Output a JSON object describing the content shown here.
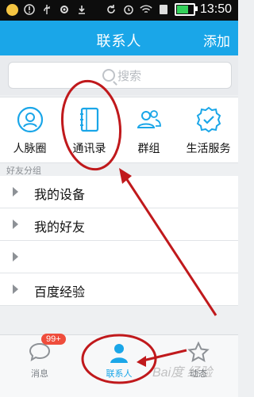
{
  "status_bar": {
    "time": "13:50",
    "left_icons": [
      "emoji-icon",
      "alert-circle-icon",
      "usb-icon",
      "gear-icon",
      "download-icon"
    ],
    "right_icons": [
      "sync-icon",
      "alarm-icon",
      "wifi-icon",
      "sim-icon",
      "battery-icon"
    ]
  },
  "header": {
    "title": "联系人",
    "action": "添加"
  },
  "search": {
    "placeholder": "搜索"
  },
  "quick_actions": [
    {
      "label": "人脉圈",
      "icon": "contacts-circle-icon"
    },
    {
      "label": "通讯录",
      "icon": "address-book-icon"
    },
    {
      "label": "群组",
      "icon": "group-icon"
    },
    {
      "label": "生活服务",
      "icon": "service-badge-icon"
    }
  ],
  "friend_groups": {
    "header": "好友分组",
    "items": [
      {
        "label": "我的设备"
      },
      {
        "label": "我的好友"
      },
      {
        "label": ""
      },
      {
        "label": "百度经验"
      }
    ]
  },
  "tab_bar": {
    "tabs": [
      {
        "label": "消息",
        "badge": "99+",
        "icon": "chat-icon",
        "active": false
      },
      {
        "label": "联系人",
        "icon": "person-icon",
        "active": true
      },
      {
        "label": "动态",
        "icon": "star-icon",
        "active": false
      }
    ]
  },
  "watermark": "Bai度 经验",
  "colors": {
    "accent": "#1aa6e8",
    "annotation_red": "#c0191c",
    "badge_red": "#ef4d3c"
  }
}
